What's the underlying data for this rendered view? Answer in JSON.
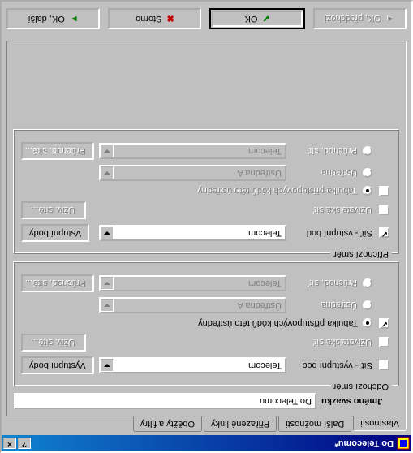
{
  "title": "Do Telecomu*",
  "tabs": {
    "t0": "Vlastnosti",
    "t1": "Další možnosti",
    "t2": "Přiřazené linky",
    "t3": "Oběžty a filtry"
  },
  "bundle": {
    "label": "Jméno svazku",
    "value": "Do Telecomu"
  },
  "group_out": {
    "legend": "Odchozí směr",
    "rows": {
      "exit": {
        "label": "Síť - výstupní bod",
        "combo": "Telecom",
        "btn": "Výstupní body"
      },
      "user": {
        "label": "Uživatelská síť",
        "btn": "Uživ. sítě..."
      },
      "codes": {
        "label": "Tabulka přístupových kódů této ústředny"
      },
      "pbx": {
        "label": "Ústředna",
        "combo": "Ústředna A"
      },
      "trnet": {
        "label": "Průchod. síť",
        "combo": "Telecom",
        "btn": "Průchod. sítě..."
      }
    }
  },
  "group_in": {
    "legend": "Příchozí směr",
    "rows": {
      "entry": {
        "label": "Síť - vstupní bod",
        "combo": "Telecom",
        "btn": "Vstupní body"
      },
      "user": {
        "label": "Uživatelská síť",
        "btn": "Uživ. sítě..."
      },
      "codes": {
        "label": "Tabulka přístupových kódů této ústředny"
      },
      "pbx": {
        "label": "Ústředna",
        "combo": "Ústředna A"
      },
      "trnet": {
        "label": "Průchod. síť",
        "combo": "Telecom",
        "btn": "Průchod. sítě..."
      }
    }
  },
  "buttons": {
    "prev": "OK, předchozí",
    "ok": "OK",
    "cancel": "Storno",
    "next": "OK, další"
  }
}
